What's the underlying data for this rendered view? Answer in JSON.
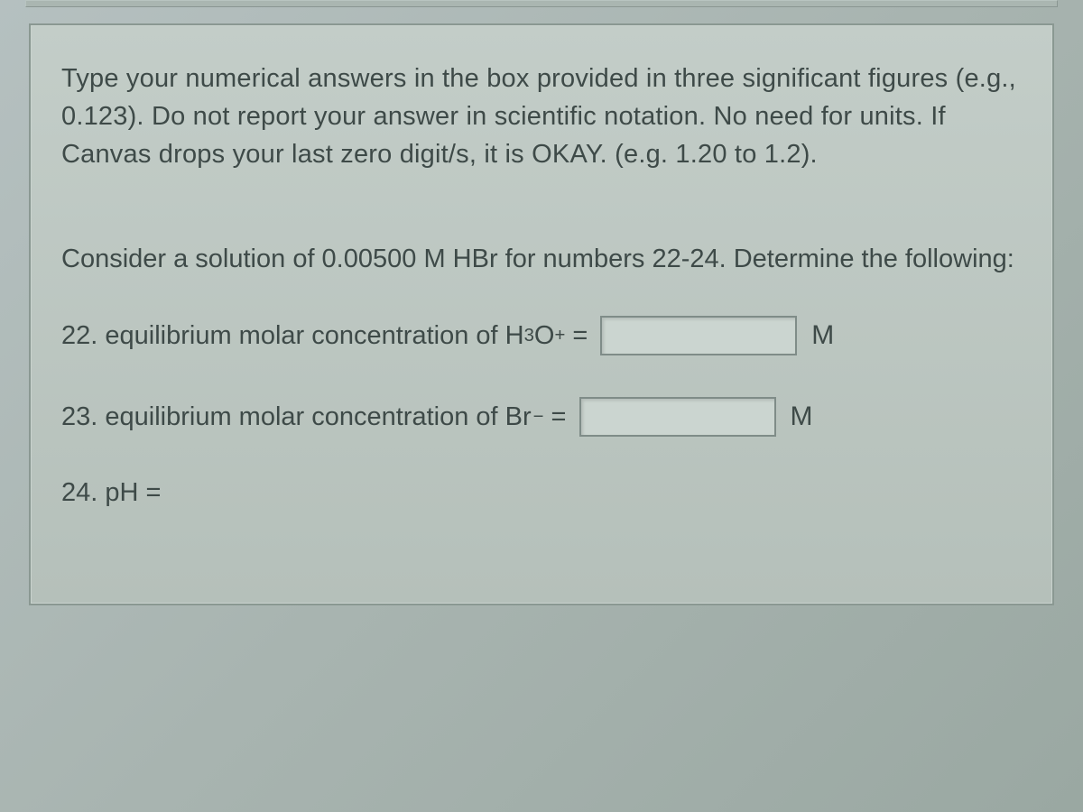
{
  "instructions": "Type your numerical answers in the box provided in three significant figures (e.g., 0.123). Do not report your answer in scientific notation. No need for units. If Canvas drops your last zero digit/s, it is OKAY. (e.g. 1.20 to 1.2).",
  "prompt": "Consider a solution of 0.00500 M HBr for numbers 22-24.  Determine the following:",
  "questions": [
    {
      "number": "22",
      "label_prefix": "22. equilibrium molar concentration of H",
      "formula_sub": "3",
      "formula_mid": "O",
      "formula_sup": "+",
      "label_suffix": " =",
      "unit": "M",
      "has_input": true
    },
    {
      "number": "23",
      "label_prefix": "23. equilibrium molar concentration of Br",
      "formula_sub": "",
      "formula_mid": "",
      "formula_sup": "−",
      "label_suffix": " =",
      "unit": "M",
      "has_input": true
    },
    {
      "number": "24",
      "label_prefix": "24. pH =",
      "formula_sub": "",
      "formula_mid": "",
      "formula_sup": "",
      "label_suffix": "",
      "unit": "",
      "has_input": false
    }
  ]
}
